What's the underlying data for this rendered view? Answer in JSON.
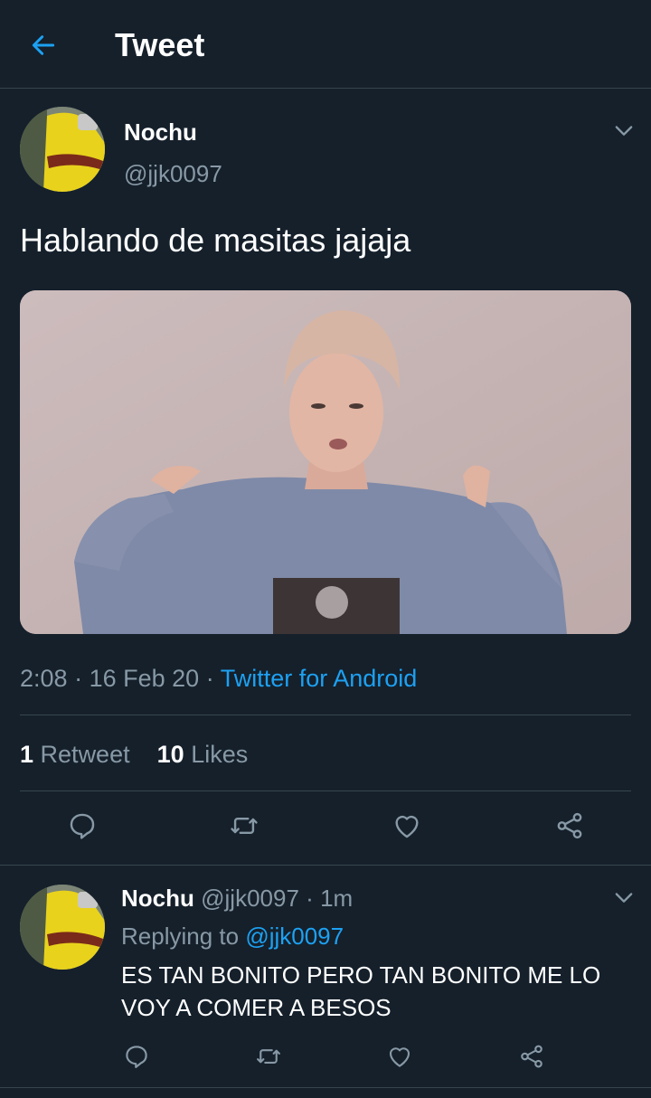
{
  "header": {
    "title": "Tweet",
    "back_icon": "arrow-left-icon",
    "accent": "#1da1f2"
  },
  "tweet": {
    "display_name": "Nochu",
    "handle": "@jjk0097",
    "text": "Hablando de masitas jajaja",
    "time": "2:08",
    "date": "16 Feb 20",
    "sep": "·",
    "source": "Twitter for Android",
    "stats": {
      "retweets": "1",
      "retweets_label": "Retweet",
      "likes": "10",
      "likes_label": "Likes"
    },
    "actions": [
      "reply-icon",
      "retweet-icon",
      "like-icon",
      "share-icon"
    ]
  },
  "reply": {
    "display_name": "Nochu",
    "handle": "@jjk0097",
    "sep": "·",
    "age": "1m",
    "replying_label": "Replying to",
    "replying_handle": "@jjk0097",
    "text": "ES TAN BONITO PERO TAN BONITO ME LO VOY A COMER A BESOS"
  },
  "colors": {
    "background": "#15202b",
    "muted": "#8899a6",
    "divider": "#38444d",
    "link": "#1da1f2"
  }
}
